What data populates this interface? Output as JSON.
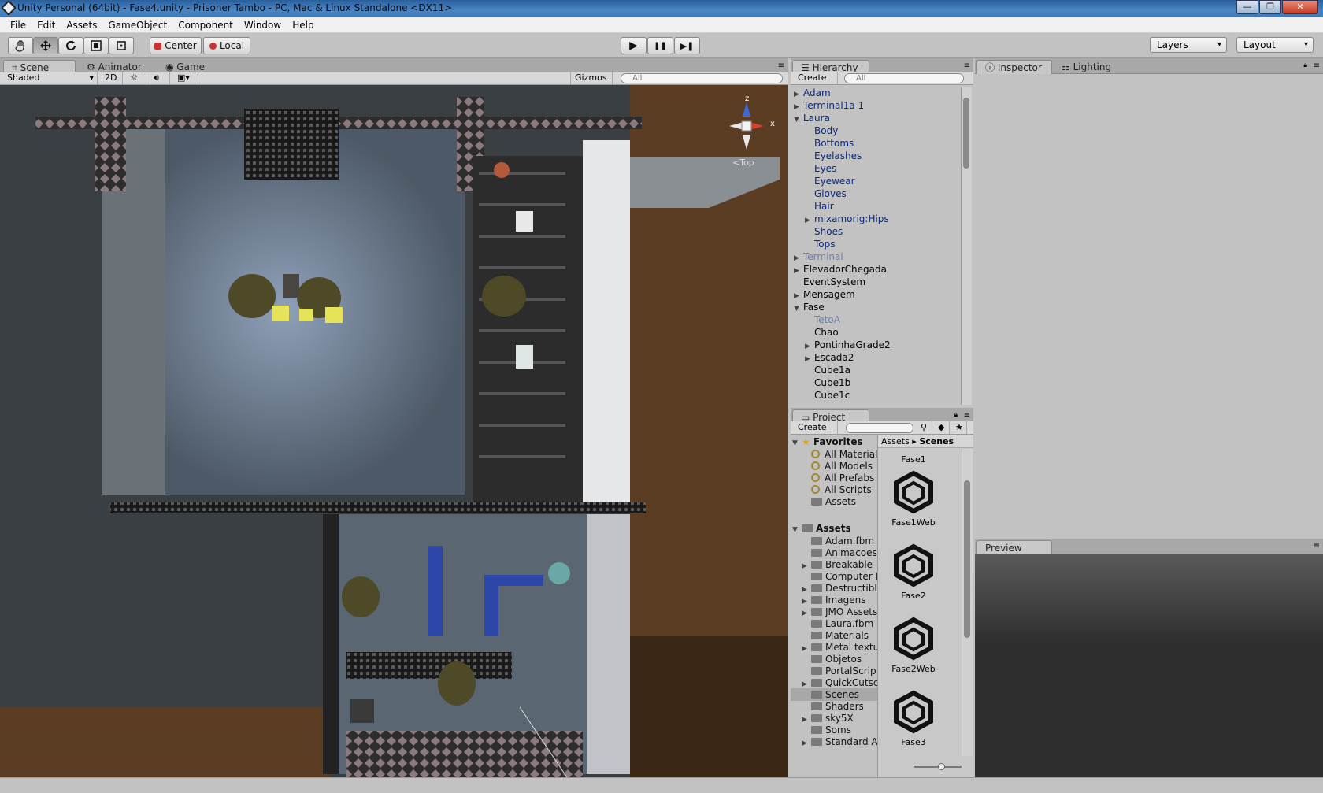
{
  "window": {
    "title": "Unity Personal (64bit) - Fase4.unity - Prisoner Tambo - PC, Mac & Linux Standalone <DX11>",
    "controls": [
      "—",
      "❐",
      "✕"
    ]
  },
  "menu": [
    "File",
    "Edit",
    "Assets",
    "GameObject",
    "Component",
    "Window",
    "Help"
  ],
  "toolbar": {
    "tools": [
      "hand-tool",
      "move-tool",
      "rotate-tool",
      "scale-tool",
      "rect-tool"
    ],
    "pivot_center": "Center",
    "pivot_local": "Local",
    "play": "▶",
    "pause": "❚❚",
    "step": "▶❚",
    "layers": "Layers",
    "layout": "Layout"
  },
  "scene_panel": {
    "tabs": [
      "Scene",
      "Animator",
      "Game"
    ],
    "shading": "Shaded",
    "mode_2d": "2D",
    "gizmos": "Gizmos",
    "search_placeholder": "All",
    "gizmo_view": "Top",
    "axis_z": "z",
    "axis_x": "x"
  },
  "hierarchy": {
    "tab": "Hierarchy",
    "create": "Create",
    "search_placeholder": "All",
    "items": [
      {
        "label": "Adam",
        "indent": 0,
        "arrow": "▶",
        "color": "blue"
      },
      {
        "label": "Terminal1a 1",
        "indent": 0,
        "arrow": "▶",
        "color": "blue"
      },
      {
        "label": "Laura",
        "indent": 0,
        "arrow": "▼",
        "color": "blue"
      },
      {
        "label": "Body",
        "indent": 1,
        "arrow": "",
        "color": "blue"
      },
      {
        "label": "Bottoms",
        "indent": 1,
        "arrow": "",
        "color": "blue"
      },
      {
        "label": "Eyelashes",
        "indent": 1,
        "arrow": "",
        "color": "blue"
      },
      {
        "label": "Eyes",
        "indent": 1,
        "arrow": "",
        "color": "blue"
      },
      {
        "label": "Eyewear",
        "indent": 1,
        "arrow": "",
        "color": "blue"
      },
      {
        "label": "Gloves",
        "indent": 1,
        "arrow": "",
        "color": "blue"
      },
      {
        "label": "Hair",
        "indent": 1,
        "arrow": "",
        "color": "blue"
      },
      {
        "label": "mixamorig:Hips",
        "indent": 1,
        "arrow": "▶",
        "color": "blue"
      },
      {
        "label": "Shoes",
        "indent": 1,
        "arrow": "",
        "color": "blue"
      },
      {
        "label": "Tops",
        "indent": 1,
        "arrow": "",
        "color": "blue"
      },
      {
        "label": "Terminal",
        "indent": 0,
        "arrow": "▶",
        "color": "grey"
      },
      {
        "label": "ElevadorChegada",
        "indent": 0,
        "arrow": "▶",
        "color": "black"
      },
      {
        "label": "EventSystem",
        "indent": 0,
        "arrow": "",
        "color": "black"
      },
      {
        "label": "Mensagem",
        "indent": 0,
        "arrow": "▶",
        "color": "black"
      },
      {
        "label": "Fase",
        "indent": 0,
        "arrow": "▼",
        "color": "black"
      },
      {
        "label": "TetoA",
        "indent": 1,
        "arrow": "",
        "color": "grey"
      },
      {
        "label": "Chao",
        "indent": 1,
        "arrow": "",
        "color": "black"
      },
      {
        "label": "PontinhaGrade2",
        "indent": 1,
        "arrow": "▶",
        "color": "black"
      },
      {
        "label": "Escada2",
        "indent": 1,
        "arrow": "▶",
        "color": "black"
      },
      {
        "label": "Cube1a",
        "indent": 1,
        "arrow": "",
        "color": "black"
      },
      {
        "label": "Cube1b",
        "indent": 1,
        "arrow": "",
        "color": "black"
      },
      {
        "label": "Cube1c",
        "indent": 1,
        "arrow": "",
        "color": "black"
      }
    ]
  },
  "project": {
    "tab": "Project",
    "create": "Create",
    "favorites_label": "Favorites",
    "favorites": [
      "All Material",
      "All Models",
      "All Prefabs",
      "All Scripts",
      "Assets"
    ],
    "assets_label": "Assets",
    "folders": [
      {
        "label": "Adam.fbm",
        "arrow": ""
      },
      {
        "label": "Animacoes",
        "arrow": ""
      },
      {
        "label": "Breakable",
        "arrow": "▶"
      },
      {
        "label": "Computer I",
        "arrow": ""
      },
      {
        "label": "Destructibl",
        "arrow": "▶"
      },
      {
        "label": "Imagens",
        "arrow": "▶"
      },
      {
        "label": "JMO Assets",
        "arrow": "▶"
      },
      {
        "label": "Laura.fbm",
        "arrow": ""
      },
      {
        "label": "Materials",
        "arrow": ""
      },
      {
        "label": "Metal textu",
        "arrow": "▶"
      },
      {
        "label": "Objetos",
        "arrow": ""
      },
      {
        "label": "PortalScrip",
        "arrow": ""
      },
      {
        "label": "QuickCutsc",
        "arrow": "▶"
      },
      {
        "label": "Scenes",
        "arrow": "",
        "selected": true
      },
      {
        "label": "Shaders",
        "arrow": ""
      },
      {
        "label": "sky5X",
        "arrow": "▶"
      },
      {
        "label": "Soms",
        "arrow": ""
      },
      {
        "label": "Standard A",
        "arrow": "▶"
      }
    ],
    "breadcrumb_root": "Assets",
    "breadcrumb_current": "Scenes",
    "top_partial_label": "Fase1",
    "scene_assets": [
      "Fase1Web",
      "Fase2",
      "Fase2Web",
      "Fase3"
    ]
  },
  "inspector": {
    "tabs": [
      "Inspector",
      "Lighting"
    ],
    "preview": "Preview"
  }
}
